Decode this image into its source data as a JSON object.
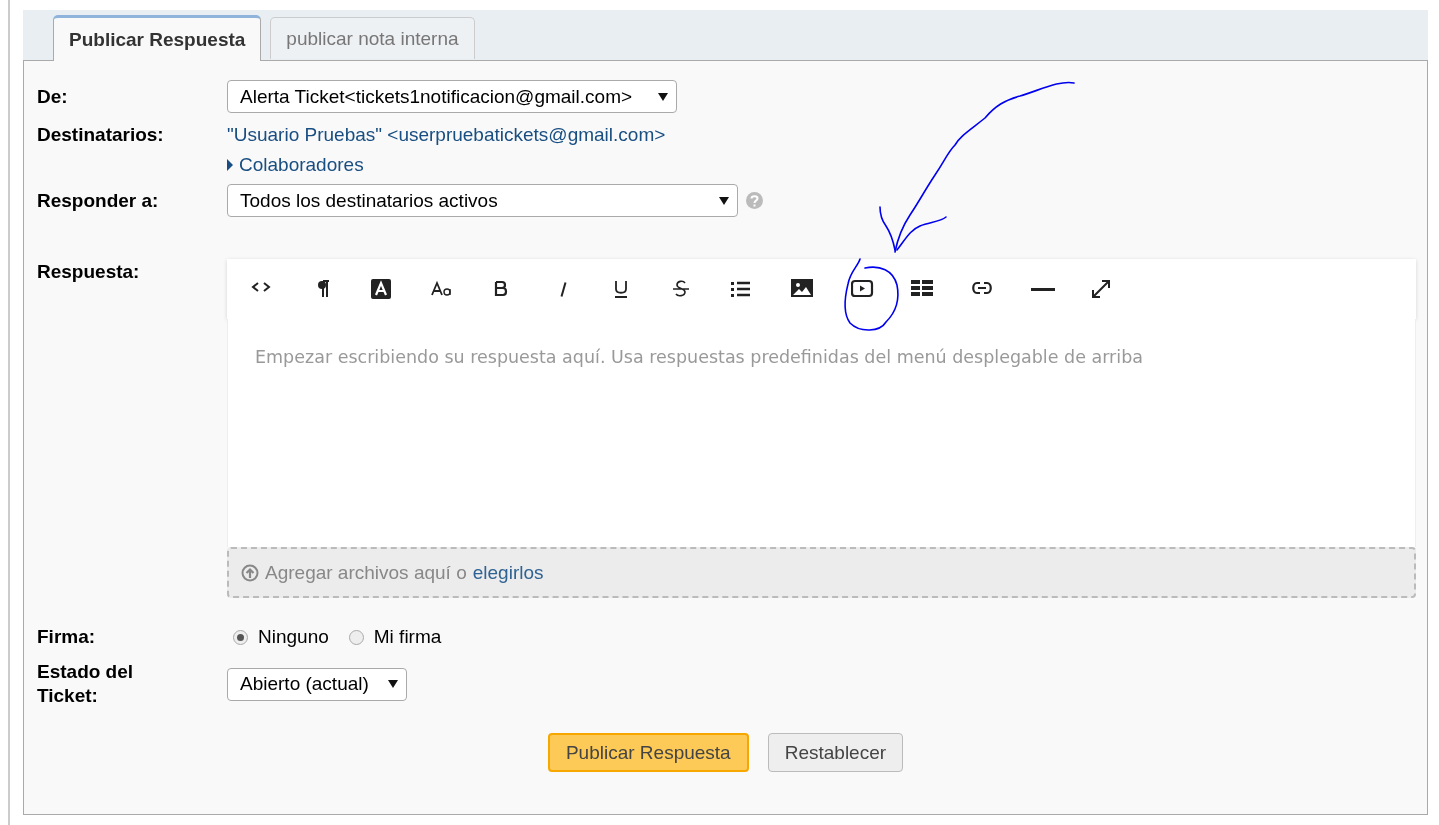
{
  "tabs": [
    {
      "label": "Publicar Respuesta",
      "selected": true
    },
    {
      "label": "publicar nota interna",
      "selected": false
    }
  ],
  "fields": {
    "from": {
      "label": "De:",
      "value": "Alerta Ticket<tickets1notificacion@gmail.com>"
    },
    "recipients": {
      "label": "Destinatarios:",
      "value": "\"Usuario Pruebas\" <userpruebatickets@gmail.com>",
      "collaborators": "Colaboradores",
      "collaborators_expanded": false
    },
    "reply_to": {
      "label": "Responder a:",
      "value": "Todos los destinatarios activos"
    },
    "response": {
      "label": "Respuesta:",
      "placeholder": "Empezar escribiendo su respuesta aquí. Usa respuestas predefinidas del menú desplegable de arriba"
    }
  },
  "toolbar": [
    {
      "kind": "code"
    },
    {
      "kind": "paragraph"
    },
    {
      "kind": "color"
    },
    {
      "kind": "fontsize"
    },
    {
      "kind": "bold"
    },
    {
      "kind": "italic"
    },
    {
      "kind": "underline"
    },
    {
      "kind": "strike"
    },
    {
      "kind": "list"
    },
    {
      "kind": "image"
    },
    {
      "kind": "video"
    },
    {
      "kind": "table"
    },
    {
      "kind": "link"
    },
    {
      "kind": "rule"
    },
    {
      "kind": "fullscreen"
    }
  ],
  "dropzone": {
    "text": "Agregar archivos aquí o",
    "link": "elegirlos"
  },
  "signature": {
    "label": "Firma:",
    "options": [
      {
        "label": "Ninguno",
        "selected": true
      },
      {
        "label": "Mi firma",
        "selected": false
      }
    ]
  },
  "status": {
    "label": "Estado del Ticket:",
    "value": "Abierto (actual)"
  },
  "buttons": [
    {
      "label": "Publicar Respuesta",
      "kind": "primary"
    },
    {
      "label": "Restablecer",
      "kind": "secondary"
    }
  ]
}
